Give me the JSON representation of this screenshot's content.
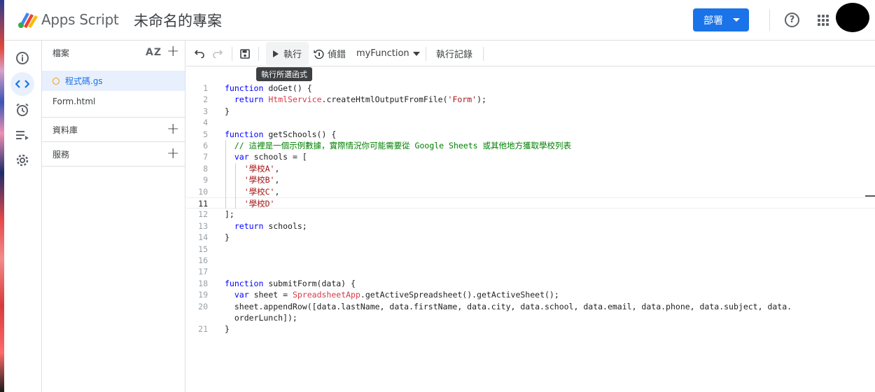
{
  "header": {
    "app_name": "Apps Script",
    "project_title": "未命名的專案",
    "deploy_label": "部署"
  },
  "files_panel": {
    "title": "檔案",
    "sort_label": "AZ",
    "files": [
      {
        "name": "程式碼.gs",
        "active": true
      },
      {
        "name": "Form.html",
        "active": false
      }
    ],
    "sections": [
      {
        "label": "資料庫"
      },
      {
        "label": "服務"
      }
    ]
  },
  "toolbar": {
    "run_label": "執行",
    "debug_label": "偵錯",
    "function_name": "myFunction",
    "log_label": "執行記錄",
    "tooltip": "執行所選函式"
  },
  "editor": {
    "current_line": 11,
    "lines": [
      {
        "n": "1",
        "html": "<span class='k'>function</span> doGet() {"
      },
      {
        "n": "2",
        "html": "  <span class='k'>return</span> <span class='t'>HtmlService</span>.createHtmlOutputFromFile(<span class='s'>'Form'</span>);"
      },
      {
        "n": "3",
        "html": "}"
      },
      {
        "n": "4",
        "html": ""
      },
      {
        "n": "5",
        "html": "<span class='k'>function</span> getSchools() {"
      },
      {
        "n": "6",
        "html": "  <span class='c'>// 這裡是一個示例數據，實際情況你可能需要從 Google Sheets 或其他地方獲取學校列表</span>"
      },
      {
        "n": "7",
        "html": "  <span class='k'>var</span> schools = ["
      },
      {
        "n": "8",
        "html": "    <span class='s'>'學校A'</span>,"
      },
      {
        "n": "9",
        "html": "    <span class='s'>'學校B'</span>,"
      },
      {
        "n": "10",
        "html": "    <span class='s'>'學校C'</span>,"
      },
      {
        "n": "11",
        "html": "    <span class='s'>'學校D'</span>"
      },
      {
        "n": "12",
        "html": "];"
      },
      {
        "n": "13",
        "html": "  <span class='k'>return</span> schools;"
      },
      {
        "n": "14",
        "html": "}"
      },
      {
        "n": "15",
        "html": ""
      },
      {
        "n": "16",
        "html": ""
      },
      {
        "n": "17",
        "html": ""
      },
      {
        "n": "18",
        "html": "<span class='k'>function</span> submitForm(data) {"
      },
      {
        "n": "19",
        "html": "  <span class='k'>var</span> sheet = <span class='t'>SpreadsheetApp</span>.getActiveSpreadsheet().getActiveSheet();"
      },
      {
        "n": "20",
        "html": "  sheet.appendRow([data.lastName, data.firstName, data.city, data.school, data.email, data.phone, data.subject, data."
      },
      {
        "n": "",
        "html": "  orderLunch]);"
      },
      {
        "n": "21",
        "html": "}"
      }
    ]
  }
}
